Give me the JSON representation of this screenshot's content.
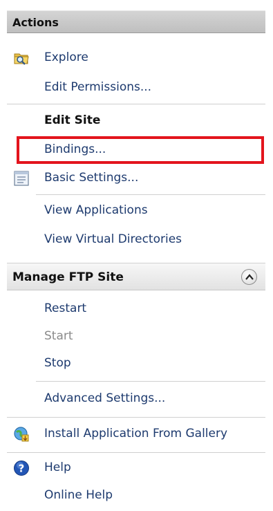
{
  "panel_title": "Actions",
  "items_top": {
    "explore": "Explore",
    "edit_permissions": "Edit Permissions..."
  },
  "edit_site": {
    "heading": "Edit Site",
    "bindings": "Bindings...",
    "basic_settings": "Basic Settings...",
    "view_applications": "View Applications",
    "view_virtual_directories": "View Virtual Directories"
  },
  "manage_ftp": {
    "heading": "Manage FTP Site",
    "restart": "Restart",
    "start": "Start",
    "stop": "Stop",
    "advanced_settings": "Advanced Settings..."
  },
  "gallery": {
    "install": "Install Application From Gallery"
  },
  "help": {
    "help": "Help",
    "online_help": "Online Help"
  },
  "colors": {
    "link": "#1d3a6e",
    "highlight": "#e3141d",
    "disabled": "#8a8a8a"
  },
  "icons": {
    "explore": "folder-search-icon",
    "basic_settings": "settings-sheet-icon",
    "collapse": "chevron-up-icon",
    "install": "gallery-install-icon",
    "help": "help-icon"
  }
}
